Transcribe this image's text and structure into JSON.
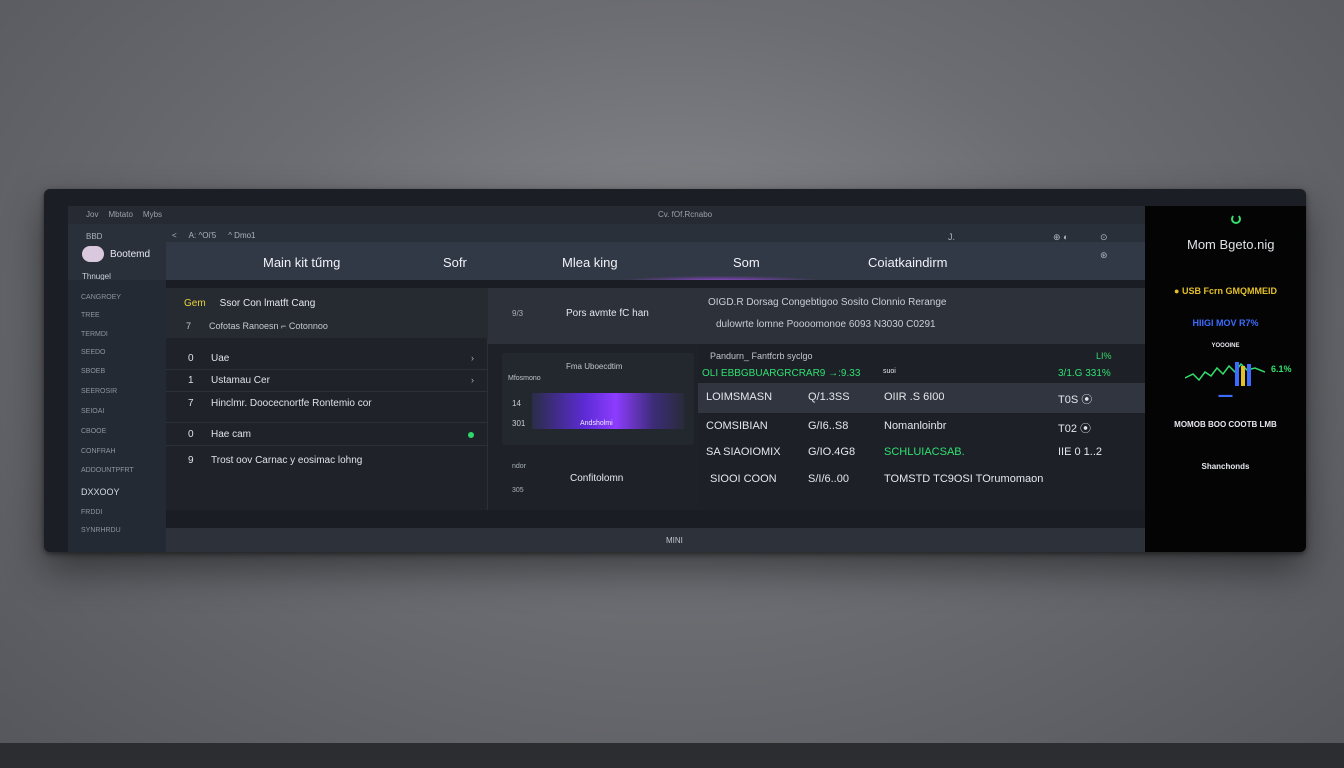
{
  "titlebar": {
    "left": [
      "Jov",
      "Mbtato",
      "Mybs"
    ],
    "center": "Cv. fOf.Rcnabo"
  },
  "brand": {
    "small": "BBD",
    "name": "Bootemd",
    "sub": "Thnugel"
  },
  "crumbs": [
    "<",
    "A: ^Oi'5",
    "^ Dmo1"
  ],
  "tabs": [
    "Main kit tűmg",
    "Sofr",
    "Mlea king",
    "Som",
    "Coiatkaindirm"
  ],
  "top_right": {
    "a": "J.",
    "b": "⊕ ◐",
    "c": "⊙",
    "d": "⊛"
  },
  "sidebar": [
    "CANGROEY",
    "TREE",
    "TERMDI",
    "SEEDO",
    "SBOEB",
    "SEEROSIR",
    "SEIOAI",
    "CBOOE",
    "CONFRAH",
    "ADDOUNTPFRT",
    "DXXOOY",
    "FRDDI",
    "SYNRHRDU"
  ],
  "left_panel": {
    "head_tag": "Gem",
    "head_title": "Ssor   Con lmatft Cang",
    "head_sub_num": "7",
    "head_sub": "Cofotas      Ranoesn ⌐   Cotonnoo",
    "rows": [
      {
        "num": "0",
        "text": "Uae",
        "marker": "›"
      },
      {
        "num": "1",
        "text": "Ustamau Cer",
        "marker": "›"
      },
      {
        "num": "7",
        "text": "Hinclmr.  Doocecnortfe  Rontemio cor",
        "marker": ""
      },
      {
        "num": "0",
        "text": "Hae cam",
        "marker": "dot"
      },
      {
        "num": "9",
        "text": "Trost oov   Carnac y eosimac lohng",
        "marker": ""
      }
    ]
  },
  "mid_panel": {
    "head_num": "9/3",
    "head_title": "Pors avmte fC han",
    "media_caption": "Fma Uboecdtim",
    "media_side": "Mfosmono",
    "media_l1": "14",
    "media_l2": "301",
    "thumb_label": "Andsholmi",
    "foot_a": "ndor",
    "foot_b": "305",
    "foot_title": "Confitolomn"
  },
  "right_panel": {
    "head_l1": "OIGD.R Dorsag     Congebtigoo   Sosito   Clonnio   Rerange",
    "head_l2": "dulowrte lomne      Poooomonoe   6093   N3030   C0291",
    "sub_left": "Pandurn_ Fantfcrb syclgo",
    "sub_right": "LI%",
    "green_row": {
      "a": "OLI EBBGBUARGRCRAR9 →:9.33",
      "b": "suoi",
      "c": "3/1.G 331%"
    },
    "rows": [
      {
        "a": "LOIMSMASN",
        "b": "Q/1.3SS",
        "c": "OIIR .S 6I00",
        "d": "T0S  ⦿"
      },
      {
        "a": "COMSIBIAN",
        "b": "G/I6..S8",
        "c": "Nomanloinbr",
        "d": "T02  ⦿"
      },
      {
        "a": "SA SIAOIOMIX",
        "b": "G/IO.4G8",
        "c": "SCHLUIACSAB.",
        "d": "IIE 0 1..2"
      },
      {
        "a": "SIOOI COON",
        "b": "S/I/6..00",
        "c": "TOMSTD   TC9OSI   TOrumomaon",
        "d": ""
      }
    ]
  },
  "statusbar": "MINI",
  "right_side": {
    "title": "Mom Bgeto.nig",
    "l1": "● USB Fcrn GMQMMEID",
    "l2": "HIIGI   MOV R7%",
    "l3": "YOOOINE",
    "pct": "6.1%",
    "l4": "MOMOB   BOO   COOTB   LMB",
    "l5": "Shanchonds"
  }
}
